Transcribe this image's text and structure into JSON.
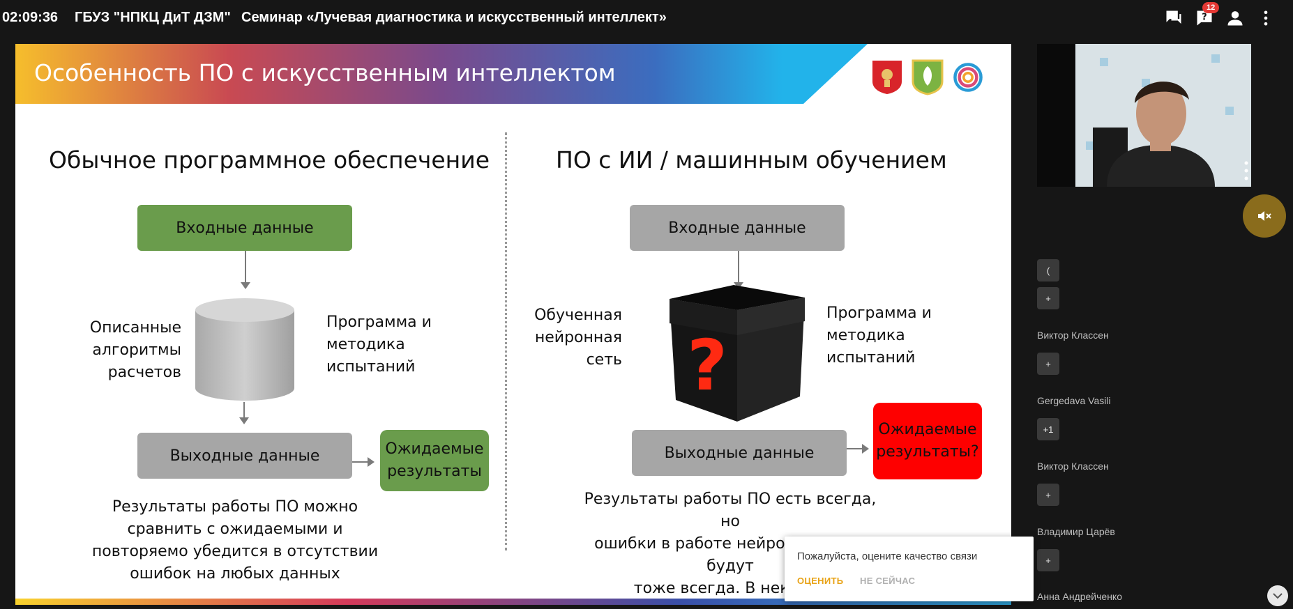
{
  "header": {
    "time": "02:09:36",
    "org": "ГБУЗ \"НПКЦ ДиТ ДЗМ\"",
    "title": "Семинар «Лучевая диагностика и искусственный интеллект»",
    "notification_count": "12",
    "icons": [
      "chat-icon",
      "question-icon",
      "person-icon",
      "more-vert-icon"
    ]
  },
  "slide": {
    "title": "Особенность ПО с искусственным интеллектом",
    "left": {
      "heading": "Обычное программное обеспечение",
      "input": "Входные данные",
      "left_label": "Описанные\nалгоритмы\nрасчетов",
      "right_label": "Программа и\nметодика\nиспытаний",
      "output": "Выходные данные",
      "expected": "Ожидаемые\nрезультаты",
      "caption": "Результаты работы ПО можно\nсравнить с ожидаемыми и\nповторяемо убедится в отсутствии\nошибок на любых данных"
    },
    "right": {
      "heading": "ПО с ИИ / машинным обучением",
      "input": "Входные данные",
      "left_label": "Обученная\nнейронная\nсеть",
      "right_label": "Программа и\nметодика\nиспытаний",
      "output": "Выходные данные",
      "expected": "Ожидаемые\nрезультаты?",
      "box_symbol": "?",
      "caption": "Результаты работы ПО есть всегда, но\nошибки в работе нейронной сети будут\nтоже всегда. В некотор\nправильный ответ не"
    },
    "colors": {
      "green": "#6a9c4c",
      "gray": "#a6a6a6",
      "red": "#fe0000"
    }
  },
  "sidebar": {
    "chips": [
      "(",
      "+",
      "+",
      "+1",
      "+",
      "+"
    ],
    "names": [
      "Виктор Классен",
      "Gergedava Vasili",
      "Виктор Классен",
      "Владимир Царёв",
      "Анна Андрейченко"
    ],
    "mute_icon": "speaker-muted-icon"
  },
  "popup": {
    "message": "Пожалуйста, оцените качество связи",
    "rate": "ОЦЕНИТЬ",
    "later": "НЕ СЕЙЧАС",
    "rate_color": "#e8a317",
    "later_color": "#b0b0b0"
  }
}
